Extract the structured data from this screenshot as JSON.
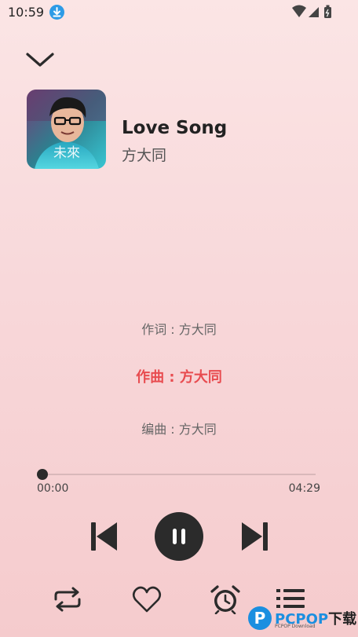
{
  "status_bar": {
    "time": "10:59",
    "icons": [
      "download-icon",
      "wifi-icon",
      "signal-icon",
      "battery-icon"
    ]
  },
  "header": {
    "collapse_icon": "chevron-down-icon"
  },
  "song": {
    "title": "Love Song",
    "artist": "方大同",
    "album_art_text": "未來"
  },
  "lyrics": {
    "lines": [
      {
        "text": "作词 : 方大同",
        "active": false
      },
      {
        "text": "作曲 : 方大同",
        "active": true
      },
      {
        "text": "编曲 : 方大同",
        "active": false
      }
    ]
  },
  "progress": {
    "elapsed": "00:00",
    "total": "04:29",
    "fraction": 0.0
  },
  "controls": {
    "prev_icon": "skip-previous-icon",
    "play_state_icon": "pause-icon",
    "next_icon": "skip-next-icon"
  },
  "bottom_bar": {
    "icons": [
      "repeat-icon",
      "heart-icon",
      "alarm-clock-icon",
      "playlist-icon"
    ]
  },
  "watermark": {
    "logo": "P",
    "brand": "PCPOP",
    "brand_suffix": "下载",
    "sub": "PCPOP Download"
  },
  "colors": {
    "accent": "#e84c50",
    "control": "#2b2b2b"
  }
}
